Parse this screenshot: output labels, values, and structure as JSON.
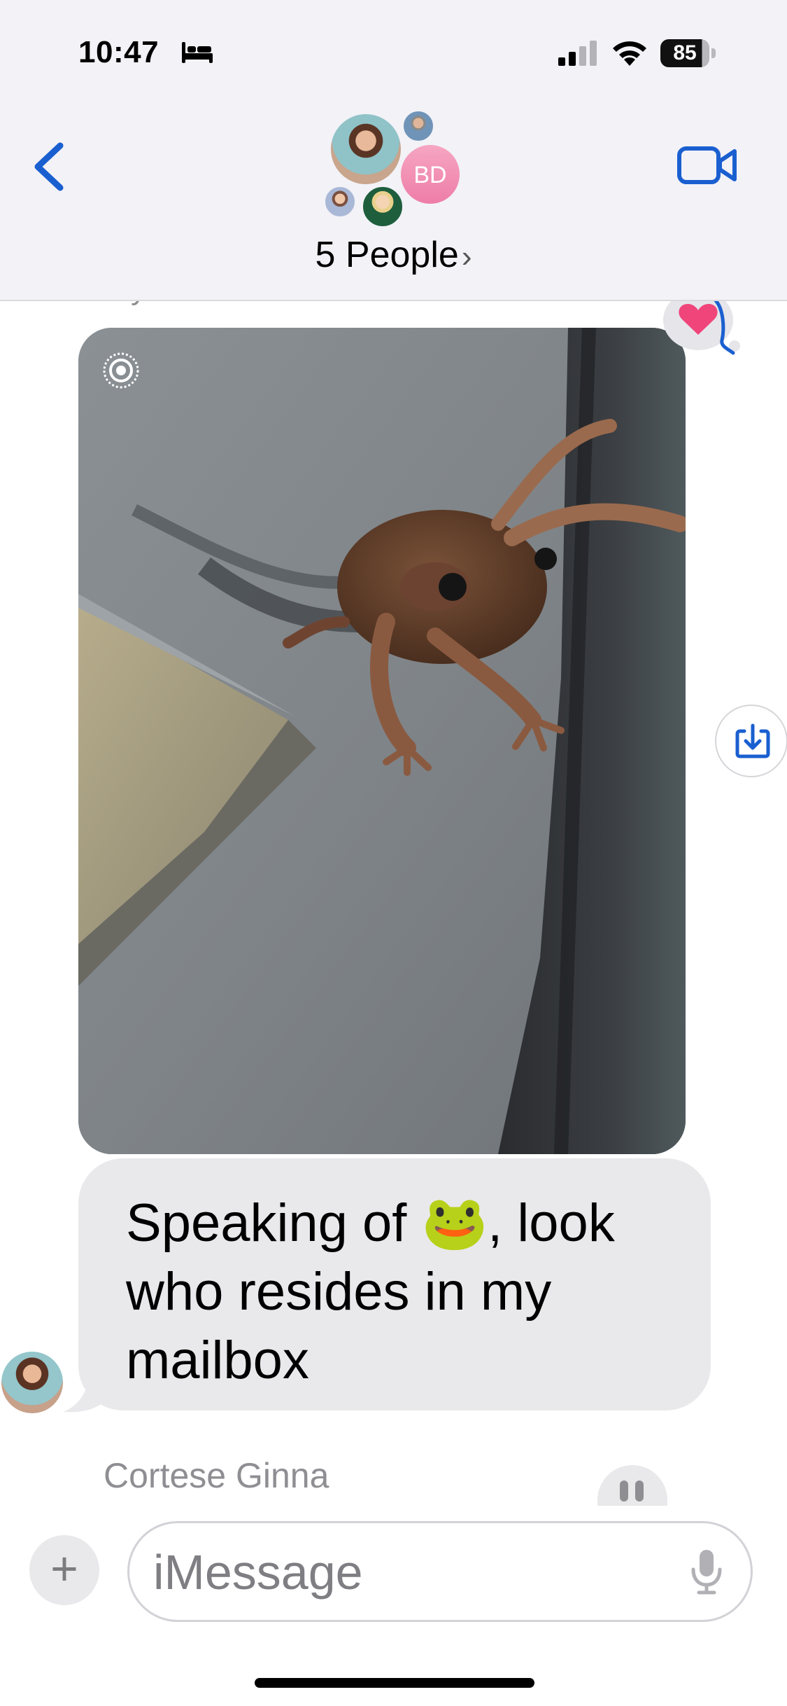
{
  "status_bar": {
    "time": "10:47",
    "battery_level": "85",
    "icons": [
      "sleep-bed-icon",
      "cellular-signal-icon",
      "wifi-icon",
      "battery-icon"
    ]
  },
  "header": {
    "group_title": "5 People",
    "title_chevron": "›",
    "avatar_initials": "BD",
    "back_icon": "chevron-left-icon",
    "video_icon": "video-camera-icon",
    "accent_color": "#1a5fd0"
  },
  "messages": {
    "previous_sender_name": "bryan tina",
    "photo_tapback": "heart-icon",
    "photo_save_icon": "save-to-photos-icon",
    "live_photo_icon": "live-photo-icon",
    "text_message_before_emoji": "Speaking of ",
    "text_message_emoji": "🐸",
    "text_message_after_emoji": ", look who resides in my mailbox",
    "bubble_color": "#e9e9eb",
    "next_sender_name": "Cortese Ginna"
  },
  "composer": {
    "plus_label": "+",
    "input_placeholder": "iMessage",
    "mic_icon": "microphone-icon"
  }
}
